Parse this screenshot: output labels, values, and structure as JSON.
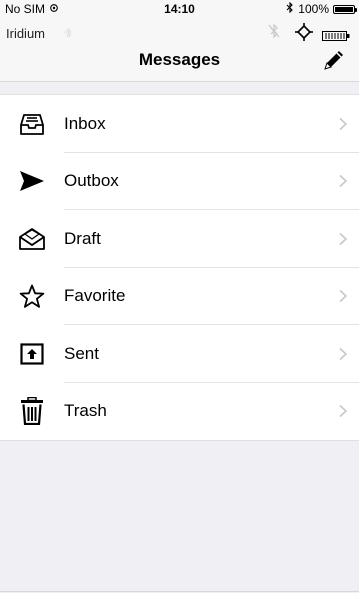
{
  "status_bar": {
    "carrier": "No SIM",
    "time": "14:10",
    "battery_percent": "100%"
  },
  "nav": {
    "device_name": "Iridium",
    "title": "Messages"
  },
  "menu": [
    {
      "label": "Inbox",
      "icon": "inbox-tray-icon"
    },
    {
      "label": "Outbox",
      "icon": "paper-plane-icon"
    },
    {
      "label": "Draft",
      "icon": "open-envelope-icon"
    },
    {
      "label": "Favorite",
      "icon": "star-icon"
    },
    {
      "label": "Sent",
      "icon": "upload-arrow-icon"
    },
    {
      "label": "Trash",
      "icon": "trash-can-icon"
    }
  ]
}
